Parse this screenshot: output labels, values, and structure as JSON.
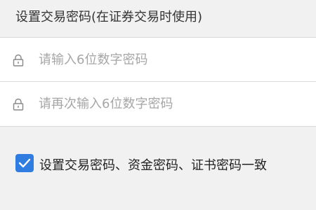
{
  "header": {
    "title": "设置交易密码(在证券交易时使用)"
  },
  "form": {
    "password": {
      "placeholder": "请输入6位数字密码",
      "value": "",
      "icon": "lock-icon"
    },
    "confirm_password": {
      "placeholder": "请再次输入6位数字密码",
      "value": "",
      "icon": "lock-icon"
    }
  },
  "agreement": {
    "checked": true,
    "label": "设置交易密码、资金密码、证书密码一致",
    "accent_color": "#2f7de1"
  }
}
